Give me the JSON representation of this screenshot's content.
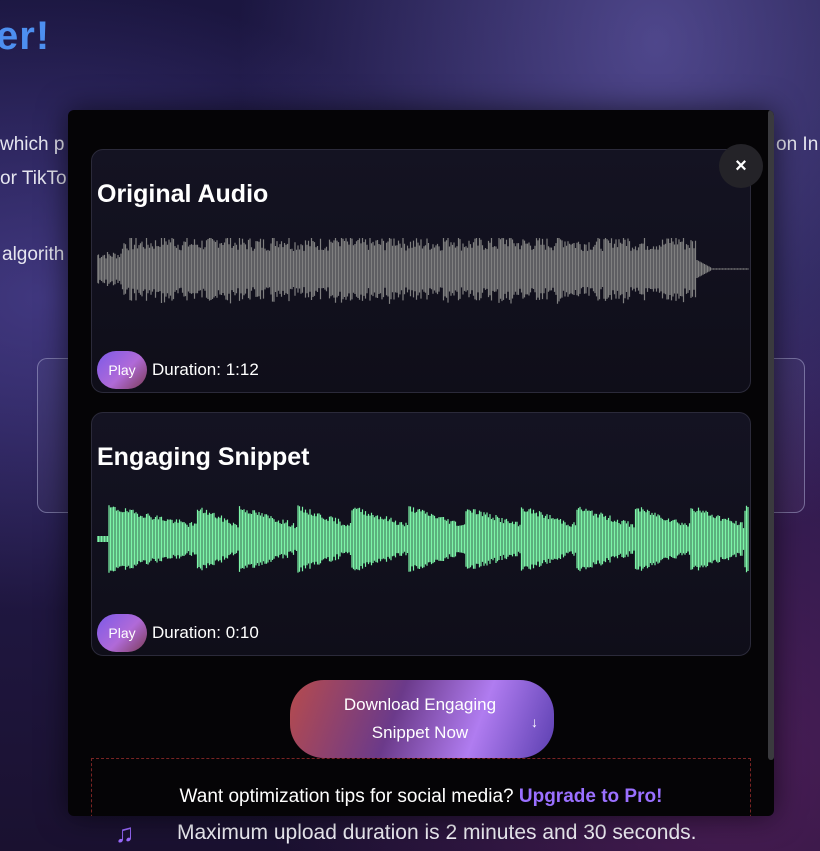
{
  "background": {
    "title": "er!",
    "line1_left": "which p",
    "line1_right": "on In",
    "line2": "or TikTo",
    "line3": "algorith",
    "footer": {
      "icon": "music-note-icon",
      "text": "Maximum upload duration is 2 minutes and 30 seconds."
    }
  },
  "modal": {
    "close_label": "×",
    "original": {
      "title": "Original Audio",
      "play_label": "Play",
      "duration": "Duration: 1:12",
      "wave_color": "#808080"
    },
    "snippet": {
      "title": "Engaging Snippet",
      "play_label": "Play",
      "duration": "Duration: 0:10",
      "wave_color": "#7df5a8"
    },
    "download": {
      "label": "Download Engaging Snippet Now",
      "icon": "↓"
    },
    "promo": {
      "text": "Want optimization tips for social media? ",
      "link": "Upgrade to Pro!"
    }
  }
}
